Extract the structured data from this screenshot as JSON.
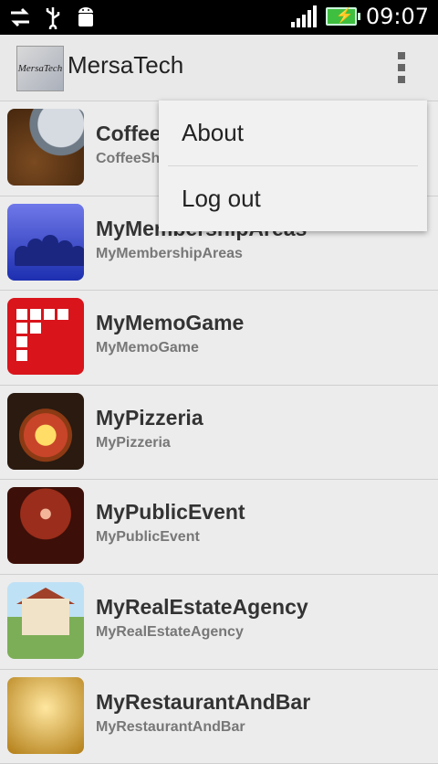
{
  "statusbar": {
    "time": "09:07",
    "icons": [
      "sync-icon",
      "usb-icon",
      "android-debug-icon",
      "signal-icon",
      "battery-charging-icon"
    ]
  },
  "actionbar": {
    "logo_text": "MersaTech",
    "title": "MersaTech"
  },
  "list": {
    "items": [
      {
        "title": "CoffeeShop",
        "subtitle": "CoffeeShop",
        "thumb": "coffee-beans"
      },
      {
        "title": "MyMembershipAreas",
        "subtitle": "MyMembershipAreas",
        "thumb": "people-silhouettes"
      },
      {
        "title": "MyMemoGame",
        "subtitle": "MyMemoGame",
        "thumb": "memo-grid"
      },
      {
        "title": "MyPizzeria",
        "subtitle": "MyPizzeria",
        "thumb": "pizza"
      },
      {
        "title": "MyPublicEvent",
        "subtitle": "MyPublicEvent",
        "thumb": "event-hall"
      },
      {
        "title": "MyRealEstateAgency",
        "subtitle": "MyRealEstateAgency",
        "thumb": "house"
      },
      {
        "title": "MyRestaurantAndBar",
        "subtitle": "MyRestaurantAndBar",
        "thumb": "restaurant"
      }
    ]
  },
  "menu": {
    "items": [
      "About",
      "Log out"
    ]
  }
}
